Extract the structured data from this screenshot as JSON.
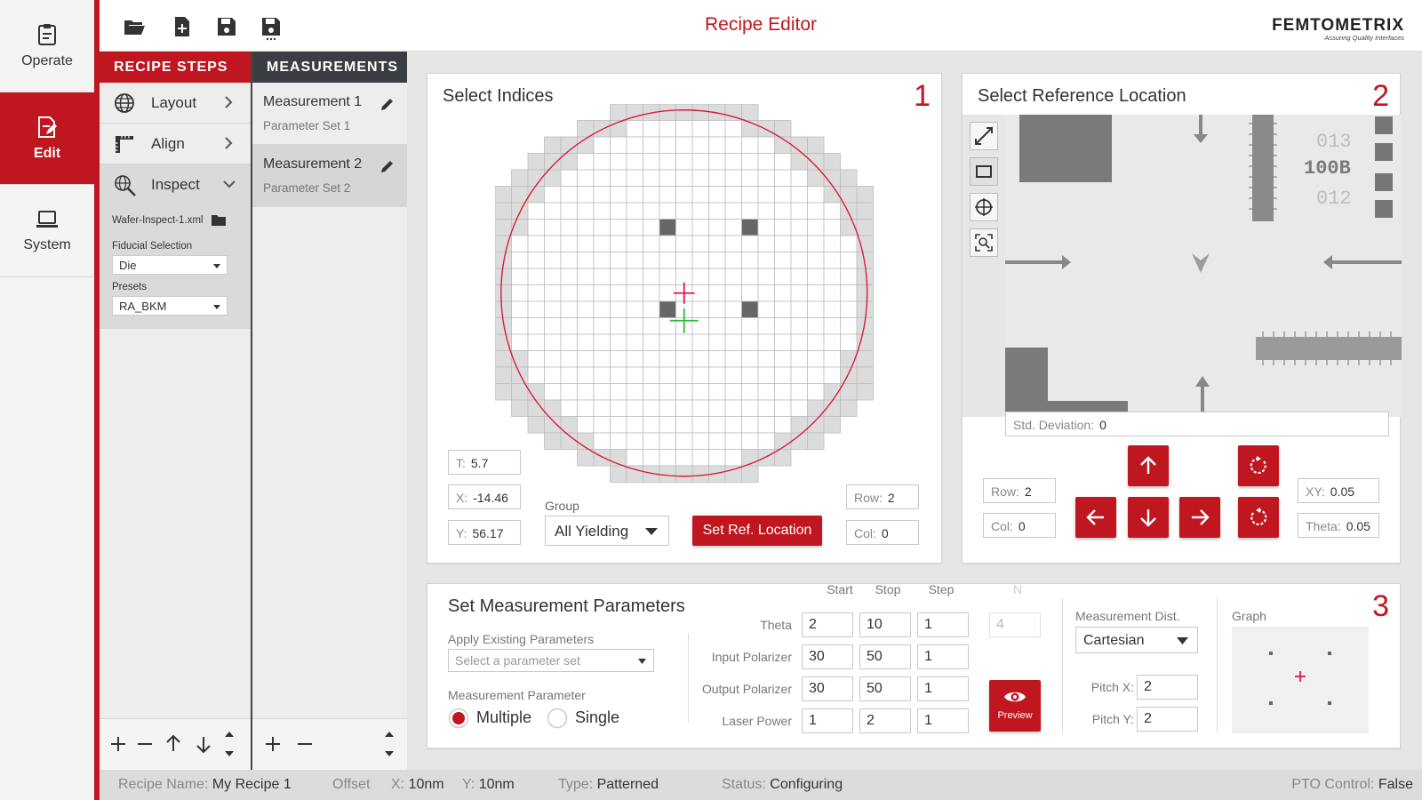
{
  "app": {
    "title": "Recipe Editor",
    "logo_name": "FEMTOMETRIX",
    "logo_tagline": "Assuring Quality Interfaces"
  },
  "nav": {
    "operate": "Operate",
    "edit": "Edit",
    "system": "System"
  },
  "toolbar": {
    "open": "folder-open-icon",
    "new": "file-add-icon",
    "save": "save-icon",
    "save_as": "save-as-icon"
  },
  "steps": {
    "header": "RECIPE STEPS",
    "items": [
      {
        "label": "Layout"
      },
      {
        "label": "Align"
      },
      {
        "label": "Inspect"
      }
    ],
    "file": "Wafer-Inspect-1.xml",
    "fiducial_label": "Fiducial Selection",
    "fiducial_value": "Die",
    "presets_label": "Presets",
    "presets_value": "RA_BKM"
  },
  "measurements": {
    "header": "MEASUREMENTS",
    "items": [
      {
        "title": "Measurement 1",
        "subtitle": "Parameter Set 1"
      },
      {
        "title": "Measurement 2",
        "subtitle": "Parameter Set 2"
      }
    ]
  },
  "indices": {
    "title": "Select Indices",
    "number": "1",
    "t": {
      "label": "T:",
      "value": "5.7"
    },
    "x": {
      "label": "X:",
      "value": "-14.46"
    },
    "y": {
      "label": "Y:",
      "value": "56.17"
    },
    "group_label": "Group",
    "group_value": "All Yielding",
    "set_ref": "Set Ref. Location",
    "row": {
      "label": "Row:",
      "value": "2"
    },
    "col": {
      "label": "Col:",
      "value": "0"
    },
    "wafer_rows": [
      [
        7,
        16
      ],
      [
        5,
        18
      ],
      [
        3,
        20
      ],
      [
        2,
        21
      ],
      [
        1,
        22
      ],
      [
        0,
        23
      ],
      [
        0,
        23
      ],
      [
        0,
        23
      ],
      [
        0,
        23
      ],
      [
        0,
        23
      ],
      [
        0,
        23
      ],
      [
        0,
        23
      ],
      [
        0,
        23
      ],
      [
        0,
        23
      ],
      [
        0,
        23
      ],
      [
        0,
        23
      ],
      [
        0,
        23
      ],
      [
        0,
        23
      ],
      [
        1,
        22
      ],
      [
        2,
        21
      ],
      [
        3,
        20
      ],
      [
        5,
        18
      ],
      [
        7,
        16
      ]
    ],
    "selected_dies": [
      [
        7,
        10
      ],
      [
        7,
        15
      ],
      [
        12,
        10
      ],
      [
        12,
        15
      ]
    ],
    "colors": {
      "wafer_outline": "#d81b3c",
      "ref_cross": "#e0194a",
      "cur_cross": "#2ebd3d"
    }
  },
  "reference": {
    "title": "Select Reference Location",
    "number": "2",
    "tools": [
      "measure-line-icon",
      "rectangle-icon",
      "crosshair-icon",
      "zoom-fit-icon"
    ],
    "image_labels": [
      "013",
      "100B",
      "012"
    ],
    "std_dev": {
      "label": "Std. Deviation:",
      "value": "0"
    },
    "row": {
      "label": "Row:",
      "value": "2"
    },
    "col": {
      "label": "Col:",
      "value": "0"
    },
    "xy": {
      "label": "XY:",
      "value": "0.05"
    },
    "theta": {
      "label": "Theta:",
      "value": "0.05"
    }
  },
  "params": {
    "title": "Set Measurement Parameters",
    "number": "3",
    "apply_label": "Apply Existing Parameters",
    "apply_placeholder": "Select a parameter set",
    "mode_label": "Measurement Parameter",
    "mode_multiple": "Multiple",
    "mode_single": "Single",
    "headers": {
      "start": "Start",
      "stop": "Stop",
      "step": "Step",
      "n": "N"
    },
    "rows": [
      {
        "label": "Theta",
        "start": "2",
        "stop": "10",
        "step": "1"
      },
      {
        "label": "Input Polarizer",
        "start": "30",
        "stop": "50",
        "step": "1"
      },
      {
        "label": "Output Polarizer",
        "start": "30",
        "stop": "50",
        "step": "1"
      },
      {
        "label": "Laser Power",
        "start": "1",
        "stop": "2",
        "step": "1"
      }
    ],
    "n_value": "4",
    "preview": "Preview",
    "dist_label": "Measurement Dist.",
    "dist_value": "Cartesian",
    "pitch_x": {
      "label": "Pitch X:",
      "value": "2"
    },
    "pitch_y": {
      "label": "Pitch Y:",
      "value": "2"
    },
    "graph_label": "Graph"
  },
  "status": {
    "recipe_name": {
      "label": "Recipe Name:",
      "value": "My Recipe 1"
    },
    "offset": "Offset",
    "x": {
      "label": "X:",
      "value": "10",
      "unit": "nm"
    },
    "y": {
      "label": "Y:",
      "value": "10",
      "unit": "nm"
    },
    "type": {
      "label": "Type:",
      "value": "Patterned"
    },
    "status": {
      "label": "Status:",
      "value": "Configuring"
    },
    "pto": {
      "label": "PTO Control:",
      "value": "False"
    }
  },
  "colors": {
    "brand_red": "#c0161f",
    "panel_bg": "#ffffff",
    "app_bg": "#e6e6e6"
  }
}
